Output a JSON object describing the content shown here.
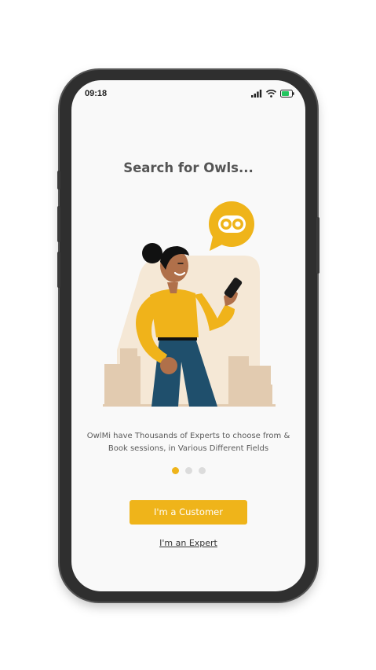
{
  "status_bar": {
    "time": "09:18",
    "battery_color": "#22c55e"
  },
  "onboarding": {
    "title": "Search for Owls...",
    "description": "OwlMi have Thousands of Experts to choose from & Book sessions, in Various Different Fields",
    "page_indicator": {
      "total": 3,
      "active": 1
    },
    "speech_bubble_icon": "owl-eyes-icon"
  },
  "actions": {
    "customer_label": "I'm a Customer",
    "expert_label": "I'm an Expert"
  },
  "colors": {
    "accent": "#efb41a",
    "text_muted": "#5a5a5a"
  }
}
